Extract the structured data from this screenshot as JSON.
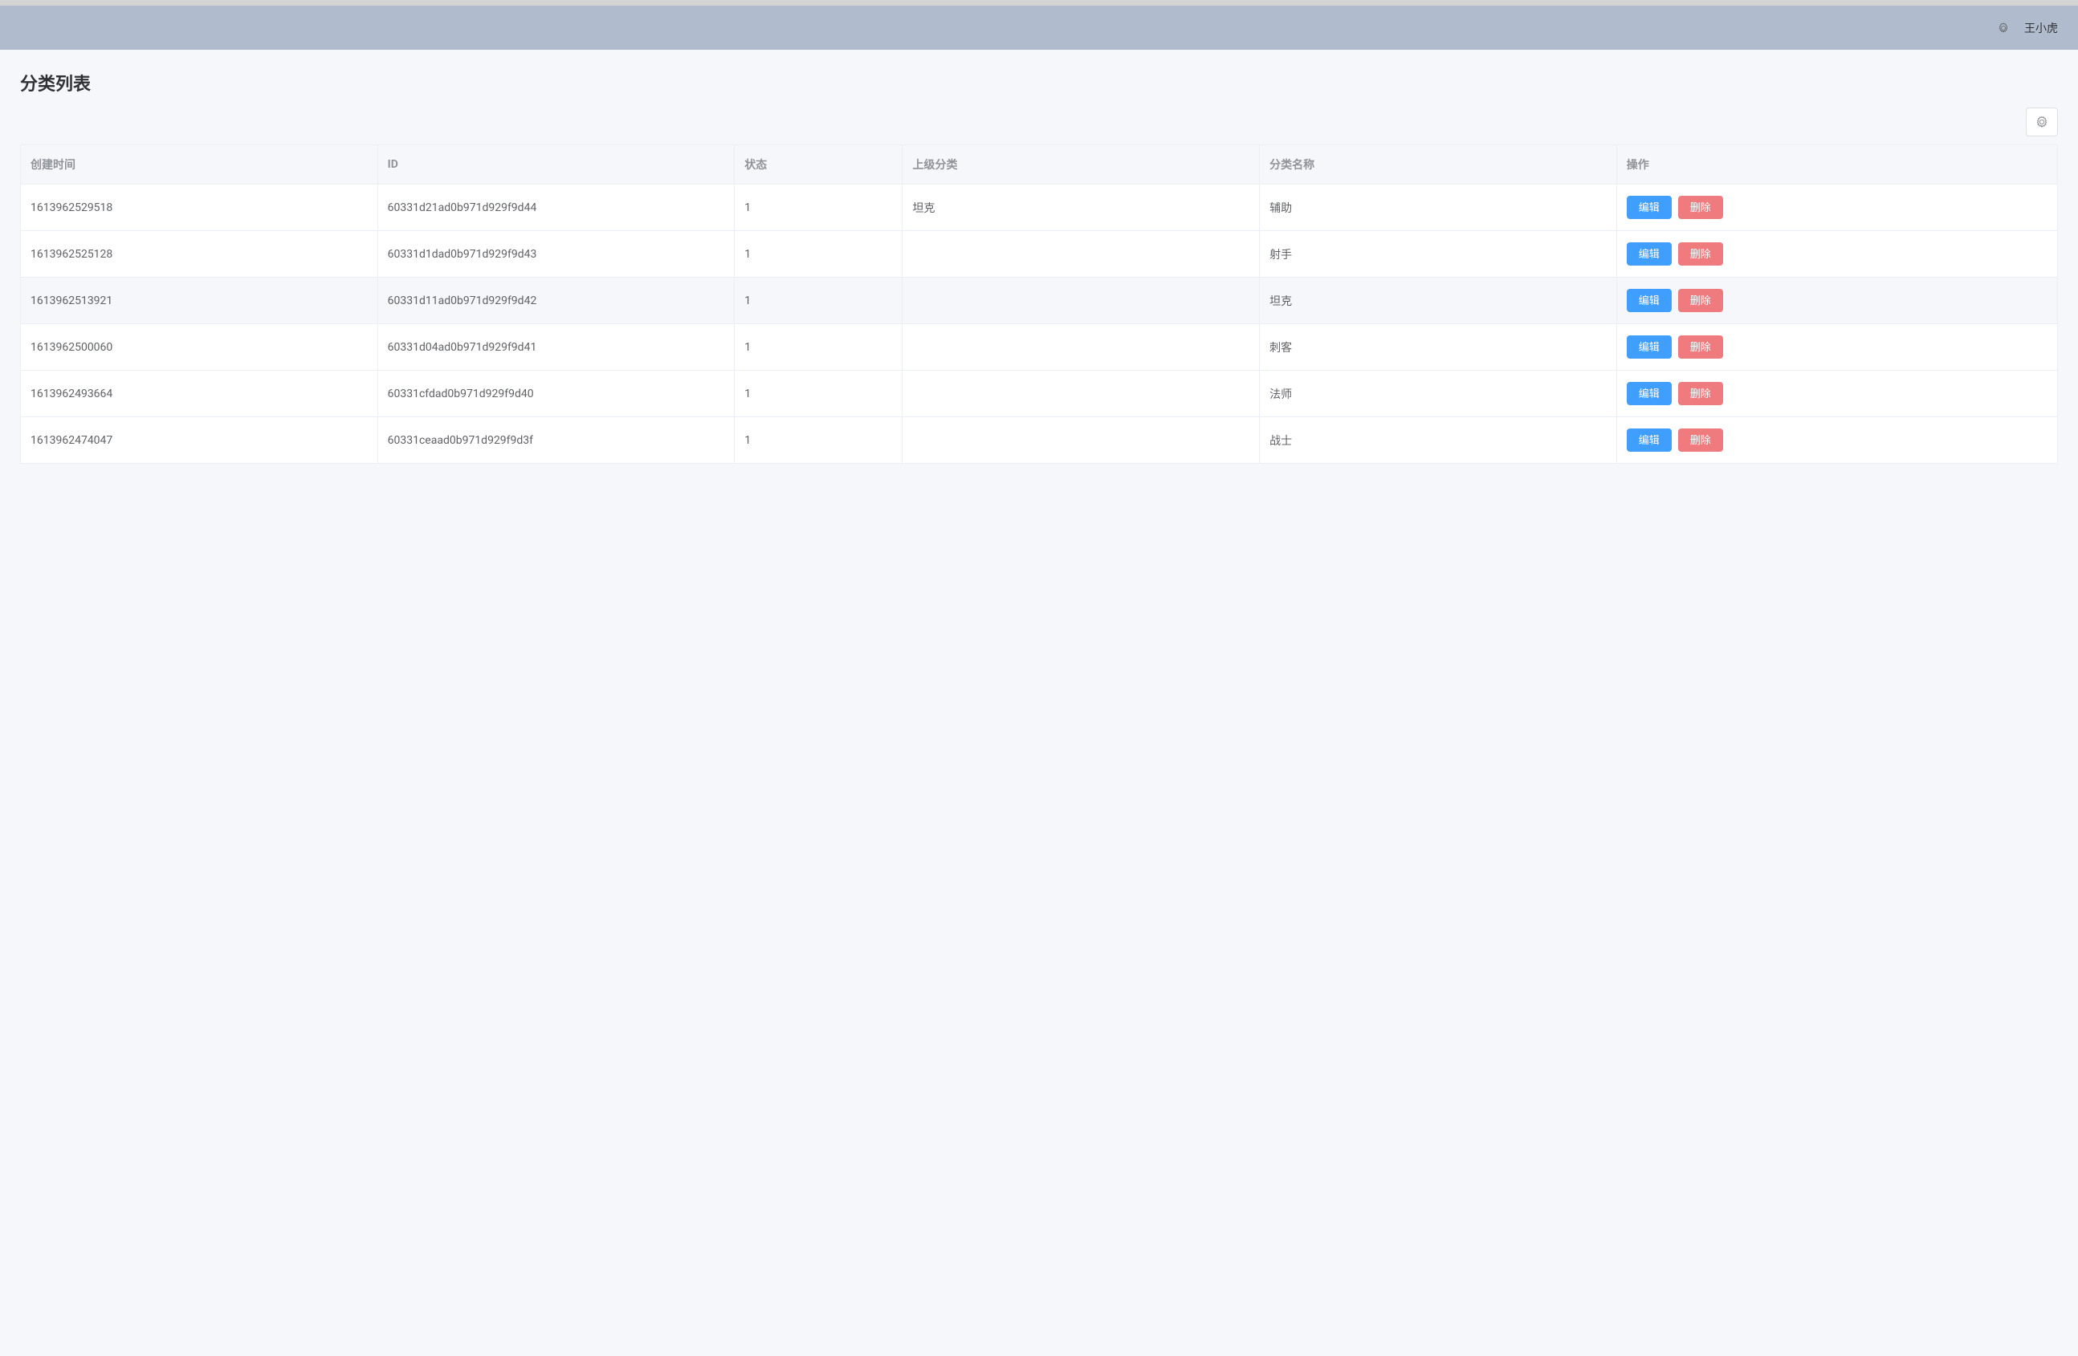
{
  "header": {
    "username": "王小虎"
  },
  "page": {
    "title": "分类列表"
  },
  "table": {
    "columns": {
      "created_at": "创建时间",
      "id": "ID",
      "status": "状态",
      "parent": "上级分类",
      "name": "分类名称",
      "actions": "操作"
    },
    "actions": {
      "edit_label": "编辑",
      "delete_label": "删除"
    },
    "rows": [
      {
        "created_at": "1613962529518",
        "id": "60331d21ad0b971d929f9d44",
        "status": "1",
        "parent": "坦克",
        "name": "辅助"
      },
      {
        "created_at": "1613962525128",
        "id": "60331d1dad0b971d929f9d43",
        "status": "1",
        "parent": "",
        "name": "射手"
      },
      {
        "created_at": "1613962513921",
        "id": "60331d11ad0b971d929f9d42",
        "status": "1",
        "parent": "",
        "name": "坦克"
      },
      {
        "created_at": "1613962500060",
        "id": "60331d04ad0b971d929f9d41",
        "status": "1",
        "parent": "",
        "name": "刺客"
      },
      {
        "created_at": "1613962493664",
        "id": "60331cfdad0b971d929f9d40",
        "status": "1",
        "parent": "",
        "name": "法师"
      },
      {
        "created_at": "1613962474047",
        "id": "60331ceaad0b971d929f9d3f",
        "status": "1",
        "parent": "",
        "name": "战士"
      }
    ]
  }
}
